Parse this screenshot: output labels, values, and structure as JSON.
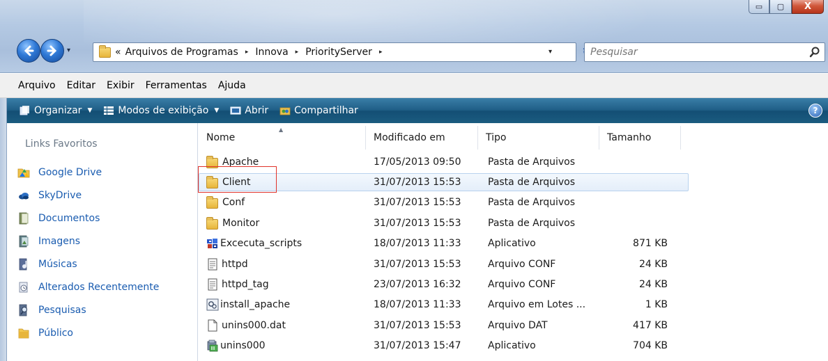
{
  "window": {
    "controls": {
      "minimize": "▭",
      "maximize": "▢",
      "close": "X"
    }
  },
  "nav": {
    "back_icon": "back-arrow-icon",
    "forward_icon": "forward-arrow-icon",
    "history_caret": "▾"
  },
  "address": {
    "overflow": "«",
    "crumbs": [
      "Arquivos de Programas",
      "Innova",
      "PriorityServer"
    ],
    "separator": "▸",
    "dropdown": "▾",
    "refresh": "↻"
  },
  "search": {
    "placeholder": "Pesquisar",
    "icon": "magnifier-icon"
  },
  "menubar": [
    "Arquivo",
    "Editar",
    "Exibir",
    "Ferramentas",
    "Ajuda"
  ],
  "commandbar": {
    "items": [
      {
        "label": "Organizar",
        "icon": "organize-icon",
        "caret": "▼"
      },
      {
        "label": "Modos de exibição",
        "icon": "views-icon",
        "caret": "▼"
      },
      {
        "label": "Abrir",
        "icon": "open-icon"
      },
      {
        "label": "Compartilhar",
        "icon": "share-icon"
      }
    ],
    "help": "?"
  },
  "navpane": {
    "heading": "Links Favoritos",
    "items": [
      {
        "label": "Google Drive",
        "icon": "google-drive-icon"
      },
      {
        "label": "SkyDrive",
        "icon": "skydrive-icon"
      },
      {
        "label": "Documentos",
        "icon": "documents-icon"
      },
      {
        "label": "Imagens",
        "icon": "pictures-icon"
      },
      {
        "label": "Músicas",
        "icon": "music-icon"
      },
      {
        "label": "Alterados Recentemente",
        "icon": "recent-icon"
      },
      {
        "label": "Pesquisas",
        "icon": "searches-icon"
      },
      {
        "label": "Público",
        "icon": "public-folder-icon"
      }
    ]
  },
  "filelist": {
    "columns": [
      "Nome",
      "Modificado em",
      "Tipo",
      "Tamanho"
    ],
    "sort_indicator": "▲",
    "rows": [
      {
        "name": "Apache",
        "date": "17/05/2013 09:50",
        "type": "Pasta de Arquivos",
        "size": "",
        "icon": "folder-icon"
      },
      {
        "name": "Client",
        "date": "31/07/2013 15:53",
        "type": "Pasta de Arquivos",
        "size": "",
        "icon": "folder-icon",
        "selected": true
      },
      {
        "name": "Conf",
        "date": "31/07/2013 15:53",
        "type": "Pasta de Arquivos",
        "size": "",
        "icon": "folder-icon"
      },
      {
        "name": "Monitor",
        "date": "31/07/2013 15:53",
        "type": "Pasta de Arquivos",
        "size": "",
        "icon": "folder-icon"
      },
      {
        "name": "Excecuta_scripts",
        "date": "18/07/2013 11:33",
        "type": "Aplicativo",
        "size": "871 KB",
        "icon": "application-icon"
      },
      {
        "name": "httpd",
        "date": "31/07/2013 15:53",
        "type": "Arquivo CONF",
        "size": "24 KB",
        "icon": "text-file-icon"
      },
      {
        "name": "httpd_tag",
        "date": "23/07/2013 16:32",
        "type": "Arquivo CONF",
        "size": "24 KB",
        "icon": "text-file-icon"
      },
      {
        "name": "install_apache",
        "date": "18/07/2013 11:33",
        "type": "Arquivo em Lotes ...",
        "size": "1 KB",
        "icon": "batch-file-icon"
      },
      {
        "name": "unins000.dat",
        "date": "31/07/2013 15:53",
        "type": "Arquivo DAT",
        "size": "417 KB",
        "icon": "blank-file-icon"
      },
      {
        "name": "unins000",
        "date": "31/07/2013 15:47",
        "type": "Aplicativo",
        "size": "704 KB",
        "icon": "uninstaller-icon"
      }
    ]
  },
  "colors": {
    "link": "#1a5cb0",
    "commandbar": "#1f5e86",
    "selection_border": "#b8d2ee",
    "annotation_red": "#e0322a"
  }
}
